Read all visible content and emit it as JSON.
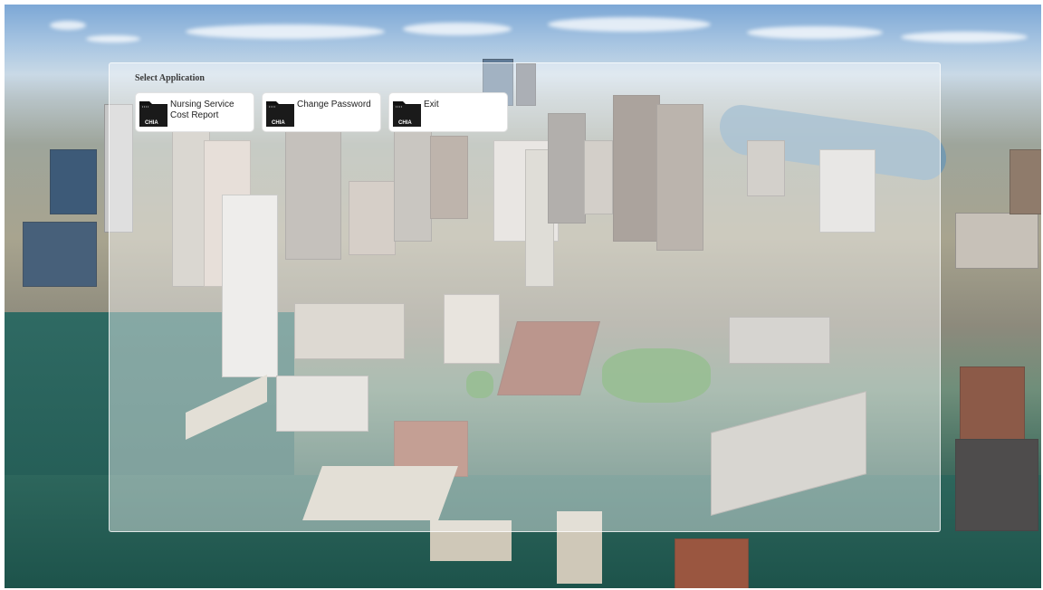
{
  "panel": {
    "title": "Select Application"
  },
  "apps": [
    {
      "label": "Nursing Service Cost Report",
      "icon": "folder-icon",
      "icon_text": "CHIA"
    },
    {
      "label": "Change Password",
      "icon": "folder-icon",
      "icon_text": "CHIA"
    },
    {
      "label": "Exit",
      "icon": "folder-icon",
      "icon_text": "CHIA"
    }
  ],
  "colors": {
    "icon_background": "#111111",
    "icon_text": "#ffffff",
    "tile_background": "#ffffff"
  }
}
